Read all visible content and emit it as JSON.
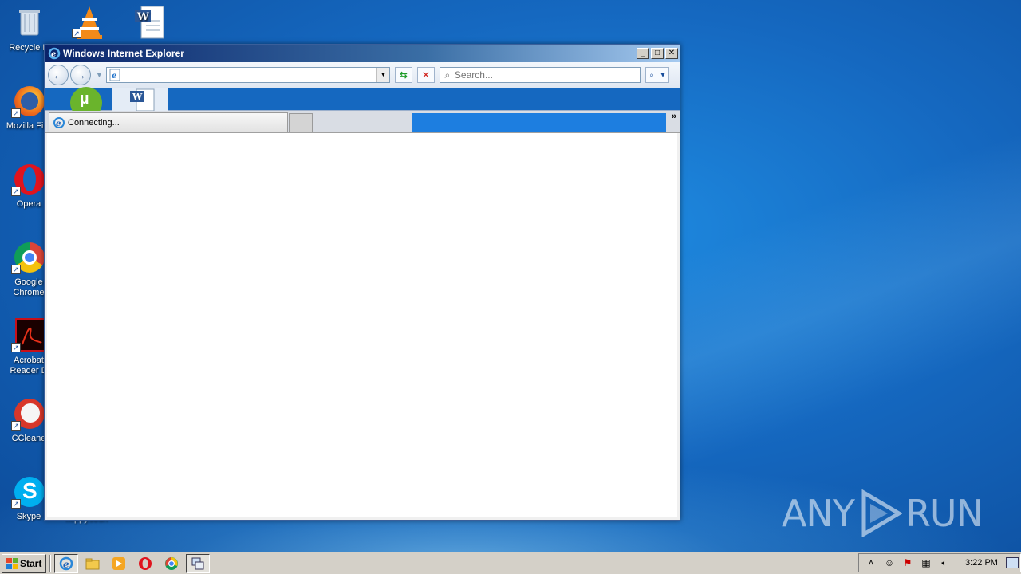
{
  "desktop": {
    "icons": [
      {
        "label": "Recycle B",
        "icon": "recycle-bin-icon"
      },
      {
        "label": "",
        "icon": "vlc-icon"
      },
      {
        "label": "",
        "icon": "word-document-icon"
      },
      {
        "label": "Mozilla Fire",
        "icon": "firefox-icon"
      },
      {
        "label": "Opera",
        "icon": "opera-icon"
      },
      {
        "label": "Google Chrome",
        "icon": "chrome-icon"
      },
      {
        "label": "Acrobat Reader D",
        "icon": "acrobat-icon"
      },
      {
        "label": "CCleane",
        "icon": "ccleaner-icon"
      },
      {
        "label": "Skype",
        "icon": "skype-icon"
      },
      {
        "label": "floppysoun",
        "icon": "file-icon"
      }
    ]
  },
  "window": {
    "title": "Windows Internet Explorer",
    "address": {
      "value": ""
    },
    "search": {
      "placeholder": "Search..."
    },
    "tab": {
      "label": "Connecting..."
    }
  },
  "taskbar": {
    "start_label": "Start",
    "clock": "3:22 PM",
    "pinned": [
      "ie-icon",
      "folder-icon",
      "media-player-icon",
      "opera-icon",
      "chrome-icon",
      "network-icon"
    ]
  },
  "watermark": {
    "left": "ANY",
    "right": "RUN"
  },
  "colors": {
    "accent": "#1568c0",
    "title_start": "#0a246a",
    "title_end": "#a6caf0"
  }
}
